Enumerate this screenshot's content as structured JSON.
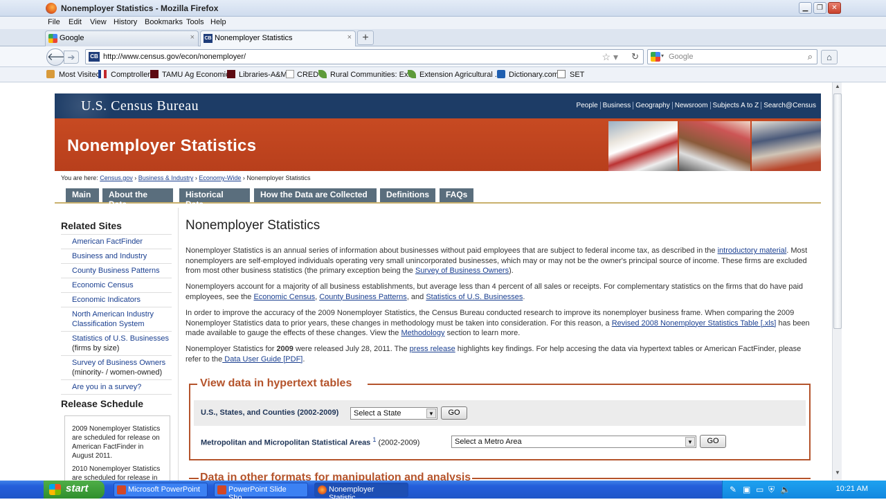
{
  "window": {
    "title": "Nonemployer Statistics - Mozilla Firefox",
    "controls": [
      "minimize",
      "maximize",
      "close"
    ]
  },
  "menu": [
    "File",
    "Edit",
    "View",
    "History",
    "Bookmarks",
    "Tools",
    "Help"
  ],
  "tabs": [
    {
      "label": "Google",
      "close": "×"
    },
    {
      "label": "Nonemployer Statistics",
      "close": "×"
    }
  ],
  "newtab_label": "+",
  "navbar": {
    "url": "http://www.census.gov/econ/nonemployer/",
    "site_badge": "CB",
    "search_placeholder": "Google"
  },
  "bookmarks": [
    "Most Visited",
    "Comptroller",
    "TAMU Ag Economics",
    "Libraries-A&M",
    "CRED",
    "Rural Communities: Ex...",
    "Extension Agricultural ...",
    "Dictionary.com",
    "SET"
  ],
  "site": {
    "agency": "U.S. Census Bureau",
    "top_nav": [
      "People",
      "Business",
      "Geography",
      "Newsroom",
      "Subjects A to Z",
      "Search@Census"
    ],
    "banner_title": "Nonemployer Statistics",
    "breadcrumb": {
      "prefix": "You are here:",
      "links": [
        "Census.gov",
        "Business & Industry",
        "Economy-Wide"
      ],
      "sep": "›",
      "current": "Nonemployer Statistics"
    },
    "main_nav": [
      "Main",
      "About the Data",
      "Historical Data",
      "How the Data are Collected",
      "Definitions",
      "FAQs"
    ]
  },
  "sidebar": {
    "related_heading": "Related Sites",
    "related": [
      {
        "label": "American FactFinder"
      },
      {
        "label": "Business and Industry"
      },
      {
        "label": "County Business Patterns"
      },
      {
        "label": "Economic Census"
      },
      {
        "label": "Economic Indicators"
      },
      {
        "label": "North American Industry Classification System"
      },
      {
        "label": "Statistics of U.S. Businesses",
        "suffix": " (firms by size)"
      },
      {
        "label": "Survey of Business Owners",
        "suffix": " (minority- / women-owned)"
      },
      {
        "label": "Are you in a survey?"
      }
    ],
    "release_heading": "Release Schedule",
    "release_items": [
      "2009 Nonemployer Statistics are scheduled for release on American FactFinder in August 2011.",
      "2010 Nonemployer Statistics are scheduled for release in"
    ]
  },
  "content": {
    "title": "Nonemployer Statistics",
    "p1": {
      "a": "Nonemployer Statistics is an annual series of information about businesses without paid employees that are subject to federal income tax, as described in the ",
      "link1": "introductory material",
      "b": ". Most nonemployers are self-employed individuals operating very small unincorporated businesses, which may or may not be the owner's principal source of income. These firms are excluded from most other business statistics (the primary exception being the ",
      "link2": "Survey of Business Owners",
      "c": ")."
    },
    "p2": {
      "a": "Nonemployers account for a majority of all business establishments, but average less than 4 percent of all sales or receipts. For complementary statistics on the firms that do have paid employees, see the ",
      "link1": "Economic Census",
      "b": ", ",
      "link2": "County Business Patterns",
      "c": ", and ",
      "link3": "Statistics of U.S. Businesses",
      "d": "."
    },
    "p3": {
      "a": "In order to improve the accuracy of the 2009 Nonemployer Statistics, the Census Bureau conducted research to improve its nonemployer business frame. When comparing the 2009 Nonemployer Statistics data to prior years, these changes in methodology must be taken into consideration. For this reason, a ",
      "link1": "Revised 2008 Nonemployer Statistics Table [.xls]",
      "b": " has been made available to gauge the effects of these changes. View the ",
      "link2": "Methodology",
      "c": " section to learn more."
    },
    "p4": {
      "a": "Nonemployer Statistics for ",
      "year": "2009",
      "b": " were released July 28, 2011. The ",
      "link1": "press release",
      "c": " highlights key findings. For help accesing the data via hypertext tables or American FactFinder, please refer to the",
      "link2": " Data User Guide [PDF]",
      "d": "."
    },
    "hypertext": {
      "legend": "View data in hypertext tables",
      "row1_label": "U.S., States, and Counties (2002-2009)",
      "row1_select": "Select a State",
      "row2_label": "Metropolitan and Micropolitan Statistical Areas",
      "row2_sup": "1",
      "row2_years": "(2002-2009)",
      "row2_select": "Select a Metro Area",
      "go": "GO"
    },
    "other_formats_legend": "Data in other formats for manipulation and analysis"
  },
  "taskbar": {
    "start": "start",
    "buttons": [
      "Microsoft PowerPoint ...",
      "PowerPoint Slide Sho...",
      "Nonemployer Statistic..."
    ],
    "clock": "10:21 AM"
  },
  "colors": {
    "census_blue": "#1d3c66",
    "banner_orange": "#c74a22",
    "legend_rust": "#b4532b",
    "link_blue": "#1a3f90"
  }
}
